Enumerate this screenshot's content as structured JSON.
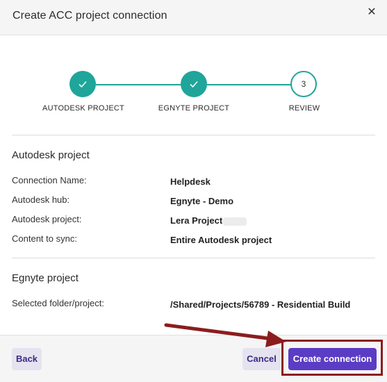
{
  "dialog": {
    "title": "Create ACC project connection",
    "close_glyph": "✕"
  },
  "stepper": {
    "steps": [
      {
        "label": "AUTODESK PROJECT",
        "state": "done",
        "glyph": "check-icon"
      },
      {
        "label": "EGNYTE PROJECT",
        "state": "done",
        "glyph": "check-icon"
      },
      {
        "label": "REVIEW",
        "state": "current",
        "number": "3"
      }
    ],
    "accent_color": "#1fa59a"
  },
  "autodesk_section": {
    "title": "Autodesk project",
    "rows": [
      {
        "label": "Connection Name:",
        "value": "Helpdesk"
      },
      {
        "label": "Autodesk hub:",
        "value": "Egnyte - Demo"
      },
      {
        "label": "Autodesk project:",
        "value": "Lera Project"
      },
      {
        "label": "Content to sync:",
        "value": "Entire Autodesk project"
      }
    ]
  },
  "egnyte_section": {
    "title": "Egnyte project",
    "rows": [
      {
        "label": "Selected folder/project:",
        "value": "/Shared/Projects/56789 - Residential Build"
      }
    ]
  },
  "footer": {
    "back_label": "Back",
    "cancel_label": "Cancel",
    "create_label": "Create connection",
    "primary_color": "#5b3cc4",
    "annotation_color": "#8b1d1d"
  }
}
